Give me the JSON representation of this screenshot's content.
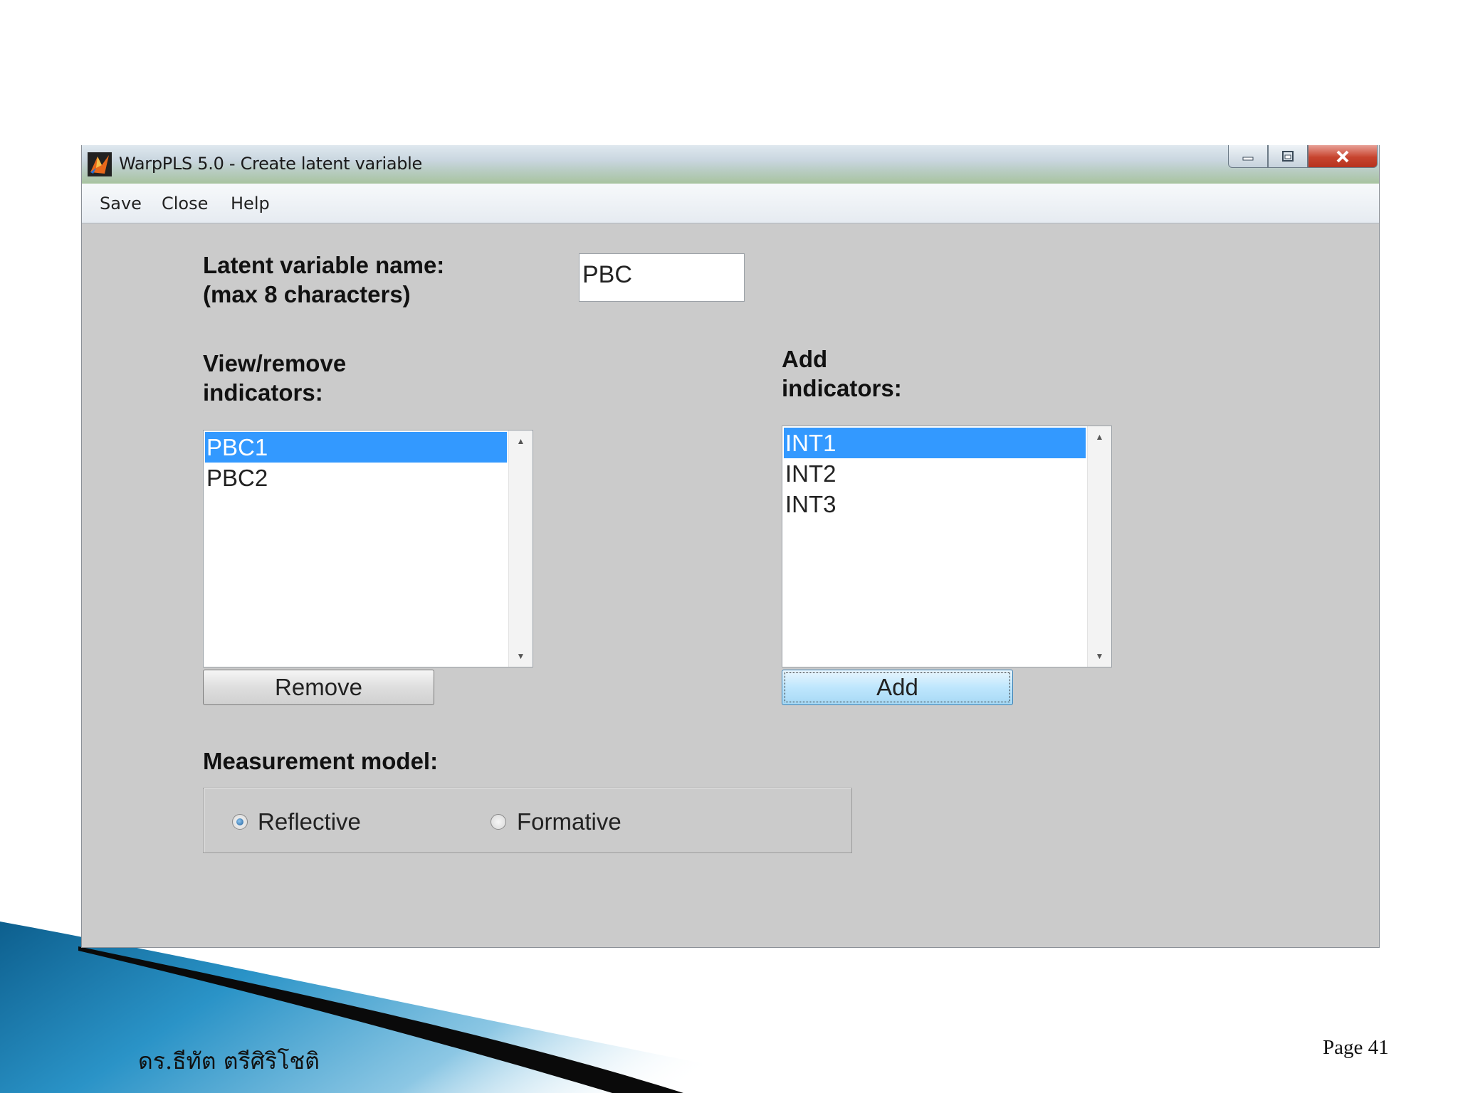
{
  "window": {
    "title": "WarpPLS 5.0 - Create latent variable",
    "menu": [
      "Save",
      "Close",
      "Help"
    ]
  },
  "form": {
    "name_label_line1": "Latent variable name:",
    "name_label_line2": "(max 8 characters)",
    "name_value": "PBC",
    "view_label_line1": "View/remove",
    "view_label_line2": "indicators:",
    "add_label_line1": "Add",
    "add_label_line2": "indicators:",
    "current_indicators": [
      "PBC1",
      "PBC2"
    ],
    "current_selected_index": 0,
    "available_indicators": [
      "INT1",
      "INT2",
      "INT3"
    ],
    "available_selected_index": 0,
    "remove_label": "Remove",
    "add_label": "Add",
    "measurement_label": "Measurement model:",
    "options": [
      "Reflective",
      "Formative"
    ],
    "selected_option": "Reflective"
  },
  "slide": {
    "author": "ดร.ธีทัต ตรีศิริโชติ",
    "page": "Page 41"
  },
  "colors": {
    "selection": "#3399ff",
    "window_bg": "#cbcbcb",
    "decor_blue": "#1f86b8"
  }
}
